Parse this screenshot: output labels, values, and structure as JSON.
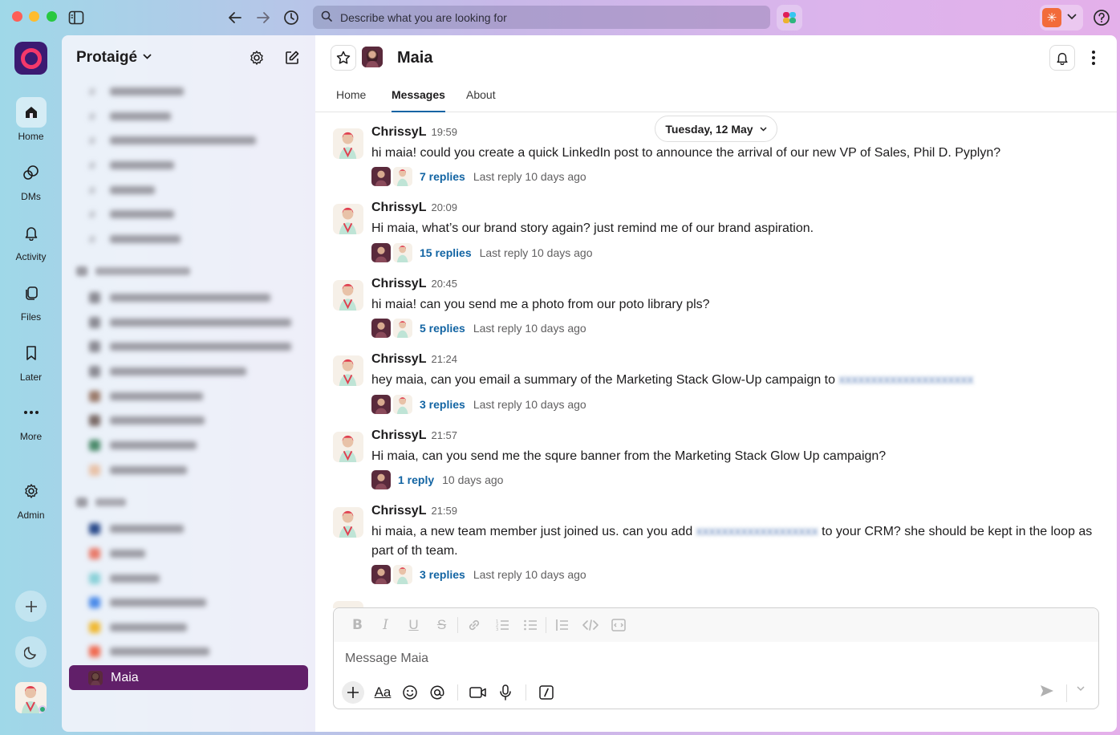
{
  "browser": {
    "search_placeholder": "Describe what you are looking for",
    "icons": [
      "sidebar-toggle-icon",
      "back-arrow-icon",
      "forward-arrow-icon",
      "history-icon",
      "search-icon",
      "help-icon"
    ]
  },
  "rail": {
    "items": [
      {
        "label": "Home",
        "icon": "home-icon"
      },
      {
        "label": "DMs",
        "icon": "dms-icon"
      },
      {
        "label": "Activity",
        "icon": "bell-icon"
      },
      {
        "label": "Files",
        "icon": "files-icon"
      },
      {
        "label": "Later",
        "icon": "bookmark-icon"
      },
      {
        "label": "More",
        "icon": "more-icon"
      },
      {
        "label": "Admin",
        "icon": "gear-icon"
      }
    ],
    "colors": {
      "brand": "#611f69",
      "logo_bg": "#3b1a72",
      "logo_ring": "#f4386a"
    }
  },
  "sidebar": {
    "workspace_name": "Protaigé",
    "active_item": "Maia"
  },
  "channel": {
    "title": "Maia",
    "tabs": [
      "Home",
      "Messages",
      "About"
    ],
    "active_tab": "Messages",
    "date_label": "Tuesday, 12 May"
  },
  "messages": [
    {
      "author": "ChrissyL",
      "time": "19:59",
      "text": "hi maia! could you create a quick LinkedIn post to announce the arrival of our new VP of Sales, Phil D. Pyplyn?",
      "replies": "7 replies",
      "last_reply": "Last reply 10 days ago"
    },
    {
      "author": "ChrissyL",
      "time": "20:09",
      "text": "Hi maia, what’s our brand story again? just remind me of our brand aspiration.",
      "replies": "15 replies",
      "last_reply": "Last reply 10 days ago"
    },
    {
      "author": "ChrissyL",
      "time": "20:45",
      "text": "hi maia! can you send me a photo from our poto library pls?",
      "replies": "5 replies",
      "last_reply": "Last reply 10 days ago"
    },
    {
      "author": "ChrissyL",
      "time": "21:24",
      "text_before": "hey maia, can you email a summary of the Marketing Stack Glow-Up campaign to",
      "replies": "3 replies",
      "last_reply": "Last reply 10 days ago"
    },
    {
      "author": "ChrissyL",
      "time": "21:57",
      "text": "Hi maia, can you send me the squre banner from the Marketing Stack Glow Up campaign?",
      "replies": "1 reply",
      "last_reply": "10 days ago"
    },
    {
      "author": "ChrissyL",
      "time": "21:59",
      "text_before": "hi maia, a new team member just joined us. can you add",
      "text_after": "to your CRM? she should be kept in the loop as part of th team.",
      "replies": "3 replies",
      "last_reply": "Last reply 10 days ago"
    }
  ],
  "composer": {
    "placeholder": "Message Maia",
    "format_icons": [
      "bold-icon",
      "italic-icon",
      "underline-icon",
      "strikethrough-icon",
      "link-icon",
      "ordered-list-icon",
      "bullet-list-icon",
      "blockquote-icon",
      "code-icon",
      "code-block-icon"
    ],
    "aa_label": "Aa"
  }
}
